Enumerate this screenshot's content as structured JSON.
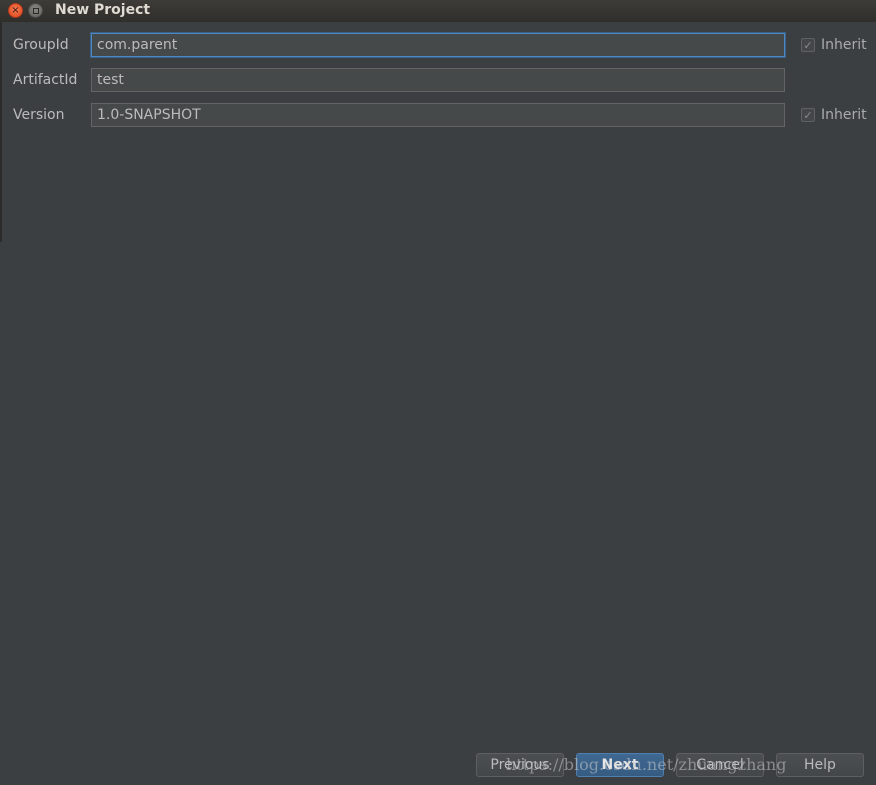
{
  "window": {
    "title": "New Project",
    "close_glyph": "×",
    "minimize_glyph": "■"
  },
  "form": {
    "group_id": {
      "label": "GroupId",
      "value": "com.parent",
      "inherit_label": "Inherit",
      "inherit_checked": true
    },
    "artifact_id": {
      "label": "ArtifactId",
      "value": "test"
    },
    "version": {
      "label": "Version",
      "value": "1.0-SNAPSHOT",
      "inherit_label": "Inherit",
      "inherit_checked": true
    }
  },
  "checkmark": "✓",
  "buttons": {
    "previous": "Previous",
    "next": "Next",
    "cancel": "Cancel",
    "help": "Help"
  },
  "watermark": "https://blog.csdn.net/zhuangzhang"
}
